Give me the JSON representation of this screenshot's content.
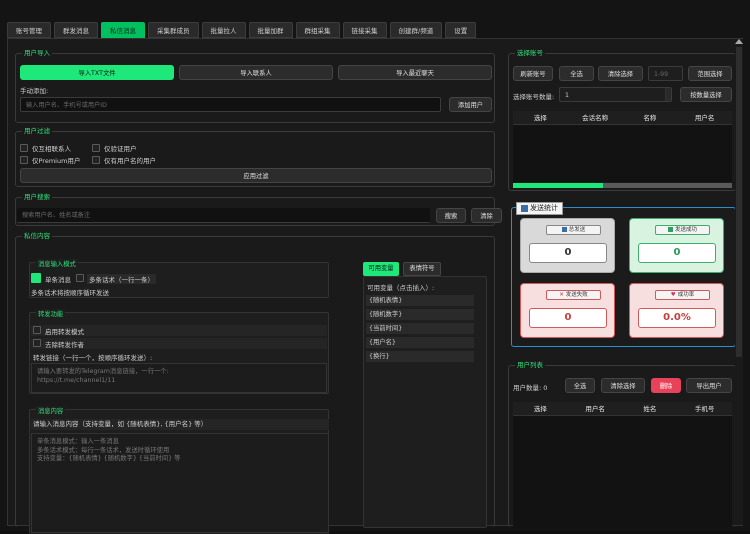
{
  "tabs": [
    "账号管理",
    "群发消息",
    "私信消息",
    "采集群成员",
    "批量拉人",
    "批量加群",
    "群组采集",
    "链接采集",
    "创建群/频道",
    "设置"
  ],
  "user_import": {
    "title": "用户导入",
    "btn_txt": "导入TXT文件",
    "btn_contacts": "导入联系人",
    "btn_recent": "导入最近聊天",
    "manual_label": "手动添加:",
    "manual_placeholder": "输入用户名、手机号或用户ID",
    "add_btn": "添加用户"
  },
  "user_filter": {
    "title": "用户过滤",
    "opt1": "仅互相联系人",
    "opt2": "仅验证用户",
    "opt3": "仅Premium用户",
    "opt4": "仅有用户名的用户",
    "apply_btn": "应用过滤"
  },
  "user_search": {
    "title": "用户搜索",
    "placeholder": "搜索用户名、姓名或备注",
    "search_btn": "搜索",
    "clear_btn": "清除"
  },
  "dm_content": {
    "title": "私信内容",
    "input_mode": {
      "title": "消息输入模式",
      "single": "单条消息",
      "multi": "多条话术（一行一条）",
      "hint": "多条话术将按顺序循环发送"
    },
    "forward": {
      "title": "转发功能",
      "enable": "启用转发模式",
      "remove_sender": "去除转发作者",
      "link_label": "转发链接（一行一个，按顺序循环发送）:",
      "link_placeholder1": "请输入要转发的Telegram消息链接，一行一个:",
      "link_placeholder2": "https://t.me/channel1/11"
    },
    "message": {
      "title": "消息内容",
      "prompt": "请输入消息内容（支持变量，如 {随机表情}, {用户名} 等）",
      "ph1": "单条消息模式：输入一条消息",
      "ph2": "多条话术模式：每行一条话术，发送时循环使用",
      "ph3": "支持变量：{随机表情} {随机数字} {当前时间} 等"
    },
    "vars": {
      "tab1": "可用变量",
      "tab2": "表情符号",
      "header": "可用变量（点击插入）:",
      "items": [
        "{随机表情}",
        "{随机数字}",
        "{当前时间}",
        "{用户名}",
        "{换行}"
      ]
    }
  },
  "select_account": {
    "title": "选择账号",
    "refresh": "刷新账号",
    "select_all": "全选",
    "clear_sel": "清除选择",
    "range_placeholder": "1-99",
    "range_btn": "范围选择",
    "count_label": "选择账号数量:",
    "count_value": "1",
    "count_btn": "按数量选择",
    "columns": [
      "选择",
      "会话名称",
      "名称",
      "用户名"
    ]
  },
  "send_stats": {
    "title": "发送统计",
    "total_label": "总发送",
    "total": "0",
    "success_label": "发送成功",
    "success": "0",
    "fail_label": "发送失败",
    "fail": "0",
    "rate_label": "成功率",
    "rate": "0.0%"
  },
  "user_list": {
    "title": "用户列表",
    "count_label": "用户数量: 0",
    "select_all": "全选",
    "clear_sel": "清除选择",
    "delete": "删除",
    "export": "导出用户",
    "columns": [
      "选择",
      "用户名",
      "姓名",
      "手机号"
    ]
  },
  "colors": {
    "accent": "#1ee87a",
    "danger": "#e8425a",
    "stats_border": "#2a8fd0"
  }
}
